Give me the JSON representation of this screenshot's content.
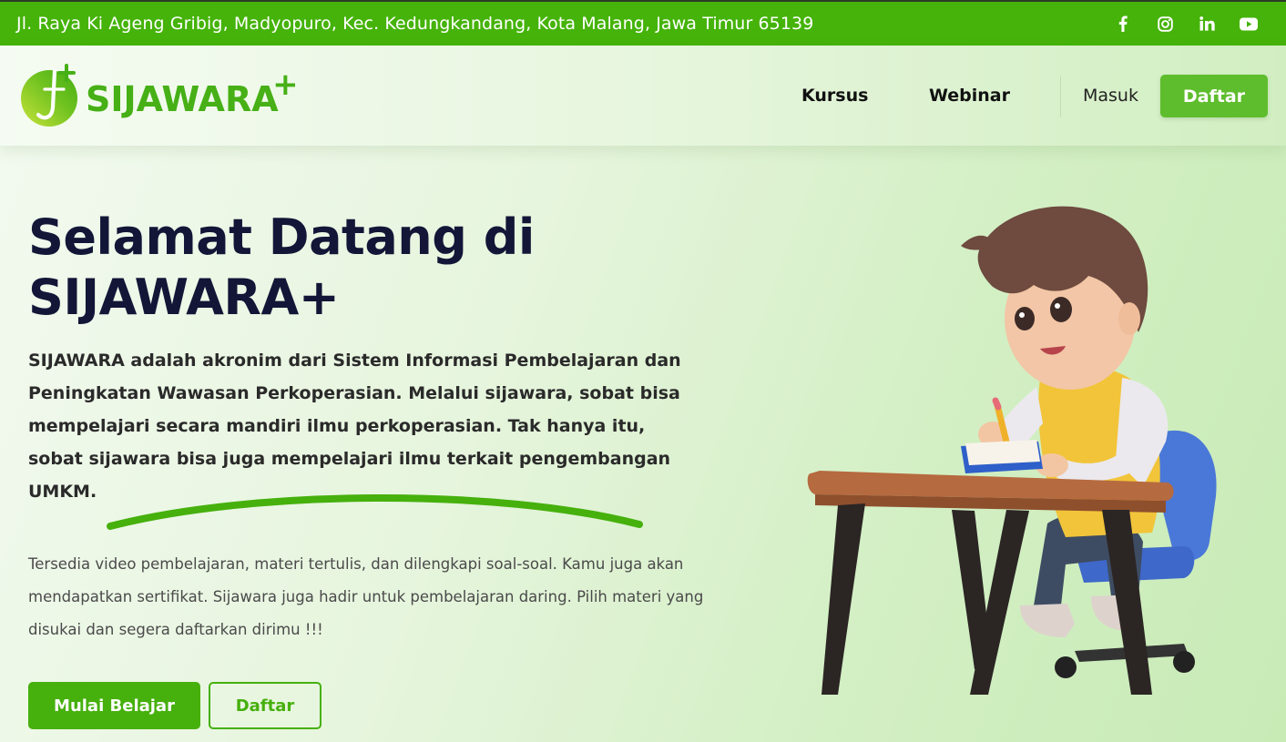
{
  "topbar": {
    "address": "Jl. Raya Ki Ageng Gribig, Madyopuro, Kec. Kedungkandang, Kota Malang, Jawa Timur 65139",
    "social_icons": [
      "facebook-icon",
      "instagram-icon",
      "linkedin-icon",
      "youtube-icon"
    ]
  },
  "header": {
    "logo_text": "SIJAWARA",
    "logo_plus": "+",
    "nav": [
      {
        "label": "Kursus"
      },
      {
        "label": "Webinar"
      }
    ],
    "login_label": "Masuk",
    "register_label": "Daftar"
  },
  "hero": {
    "title_line1": "Selamat Datang di",
    "title_line2": "SIJAWARA+",
    "lead": "SIJAWARA adalah akronim dari Sistem Informasi Pembelajaran dan Peningkatan Wawasan Perkoperasian. Melalui sijawara, sobat bisa mempelajari secara mandiri ilmu perkoperasian. Tak hanya itu, sobat sijawara bisa juga mempelajari ilmu terkait pengembangan UMKM.",
    "description": "Tersedia video pembelajaran, materi tertulis, dan dilengkapi soal-soal. Kamu juga akan mendapatkan sertifikat. Sijawara juga hadir untuk pembelajaran daring. Pilih materi yang disukai dan segera daftarkan dirimu !!!",
    "primary_button": "Mulai Belajar",
    "secondary_button": "Daftar"
  },
  "colors": {
    "brand_green": "#46b00d",
    "topbar_green": "#45b309",
    "title_navy": "#131637"
  }
}
